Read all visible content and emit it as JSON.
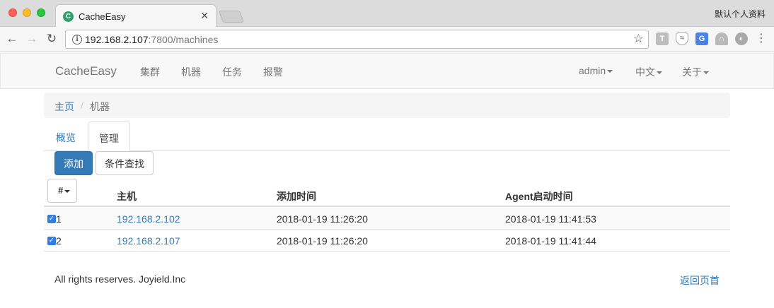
{
  "browser": {
    "tab_title": "CacheEasy",
    "tab_favicon": "C",
    "close_glyph": "✕",
    "profile_name": "默认个人资料",
    "url_host": "192.168.2.107",
    "url_path": ":7800/machines",
    "icons": [
      "back-icon",
      "forward-icon",
      "reload-icon",
      "info-icon",
      "star-icon",
      "menu-icon"
    ],
    "nav_glyphs": {
      "back": "←",
      "forward": "→",
      "reload": "↻",
      "info": "i",
      "star": "☆",
      "menu": "⋮"
    },
    "extensions": [
      {
        "name": "t-extension-icon",
        "glyph": "T"
      },
      {
        "name": "shield-extension-icon",
        "glyph": "≈"
      },
      {
        "name": "translate-extension-icon",
        "glyph": "G"
      },
      {
        "name": "arc-extension-icon",
        "glyph": "∩"
      },
      {
        "name": "globe-extension-icon",
        "glyph": "◐"
      }
    ]
  },
  "navbar": {
    "brand": "CacheEasy",
    "items": [
      "集群",
      "机器",
      "任务",
      "报警"
    ],
    "right_items": [
      "admin",
      "中文",
      "关于"
    ]
  },
  "breadcrumb": {
    "home": "主页",
    "separator": "/",
    "current": "机器"
  },
  "tabs": [
    "概览",
    "管理"
  ],
  "active_tab": "管理",
  "buttons": {
    "add": "添加",
    "search": "条件查找"
  },
  "table": {
    "column_toggle": "#",
    "headers": [
      "主机",
      "添加时间",
      "Agent启动时间"
    ],
    "rows": [
      {
        "checked": true,
        "check_glyph": "✓",
        "index": "1",
        "host": "192.168.2.102",
        "added": "2018-01-19 11:26:20",
        "agent_started": "2018-01-19 11:41:53"
      },
      {
        "checked": true,
        "check_glyph": "✓",
        "index": "2",
        "host": "192.168.2.107",
        "added": "2018-01-19 11:26:20",
        "agent_started": "2018-01-19 11:41:44"
      }
    ]
  },
  "footer": {
    "copyright": "All rights reserves. Joyield.Inc",
    "back_to_top": "返回页首"
  },
  "colors": {
    "link": "#337ab7",
    "primary_button": "#337ab7",
    "navbar_bg": "#f8f8f8"
  }
}
